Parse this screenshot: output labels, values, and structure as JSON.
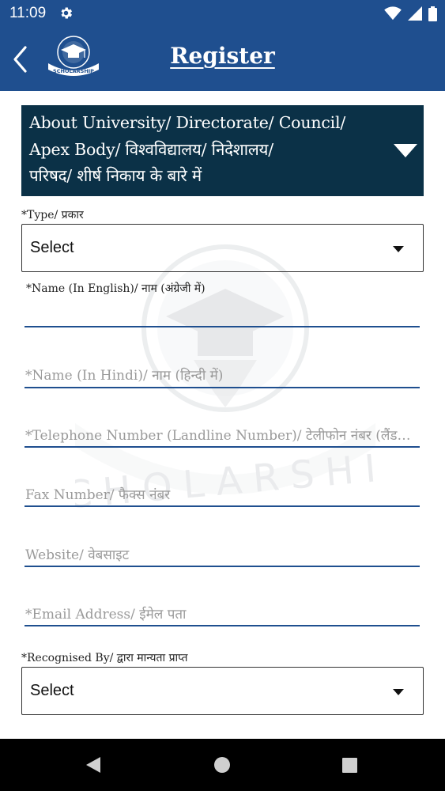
{
  "status_bar": {
    "time": "11:09"
  },
  "app_bar": {
    "title": "Register",
    "logo_text": "SCHOLARSHIP"
  },
  "section": {
    "line1": "About University/ Directorate/ Council/",
    "line2": "Apex Body/ विश्वविद्यालय/ निदेशालय/",
    "line3": "परिषद/ शीर्ष निकाय के बारे में"
  },
  "form": {
    "type_label": "*Type/ प्रकार",
    "type_value": "Select",
    "name_en_label": "*Name (In English)/ नाम (अंग्रेजी में)",
    "name_hi_placeholder": "*Name (In Hindi)/ नाम (हिन्दी में)",
    "telephone_placeholder": "*Telephone Number (Landline Number)/ टेलीफोन नंबर (लैंडलाइन नंबर)",
    "fax_placeholder": "Fax Number/ फैक्स नंबर",
    "website_placeholder": "Website/ वेबसाइट",
    "email_placeholder": "*Email Address/ ईमेल पता",
    "recognised_label": "*Recognised By/ द्वारा मान्यता प्राप्त",
    "recognised_value": "Select"
  },
  "colors": {
    "primary": "#1f4f8f",
    "section_bg": "#0b3147",
    "nav_bg": "#000000"
  }
}
